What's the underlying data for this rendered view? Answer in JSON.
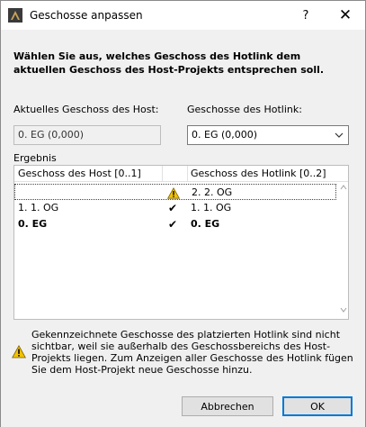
{
  "window": {
    "title": "Geschosse anpassen",
    "help_label": "?",
    "close_label": "✕"
  },
  "instruction": "Wählen Sie aus, welches Geschoss des Hotlink dem aktuellen Geschoss des Host-Projekts entsprechen soll.",
  "host": {
    "label": "Aktuelles Geschoss des Host:",
    "value": "0. EG (0,000)"
  },
  "hotlink": {
    "label": "Geschosse des Hotlink:",
    "selected": "0. EG (0,000)"
  },
  "result": {
    "label": "Ergebnis",
    "col_host": "Geschoss des Host [0..1]",
    "col_hotlink": "Geschoss des Hotlink [0..2]",
    "rows": [
      {
        "host": "",
        "mark": "⚠",
        "hotlink": "2. 2. OG"
      },
      {
        "host": "1. 1. OG",
        "mark": "✔",
        "hotlink": "1. 1. OG"
      },
      {
        "host": "0. EG",
        "mark": "✔",
        "hotlink": "0. EG"
      }
    ]
  },
  "warning": "Gekennzeichnete Geschosse des platzierten Hotlink sind nicht sichtbar, weil sie außerhalb des Geschossbereichs des Host-Projekts liegen. Zum Anzeigen aller Geschosse des Hotlink fügen Sie dem Host-Projekt neue Geschosse hinzu.",
  "buttons": {
    "cancel": "Abbrechen",
    "ok": "OK"
  },
  "colors": {
    "dialog_bg": "#f0f0f0",
    "accent": "#0078d7",
    "warning": "#f2c200"
  },
  "icons": {
    "app": "archicad-app-icon",
    "warning": "warning-triangle-icon",
    "check": "check-icon",
    "dropdown": "chevron-down-icon"
  }
}
